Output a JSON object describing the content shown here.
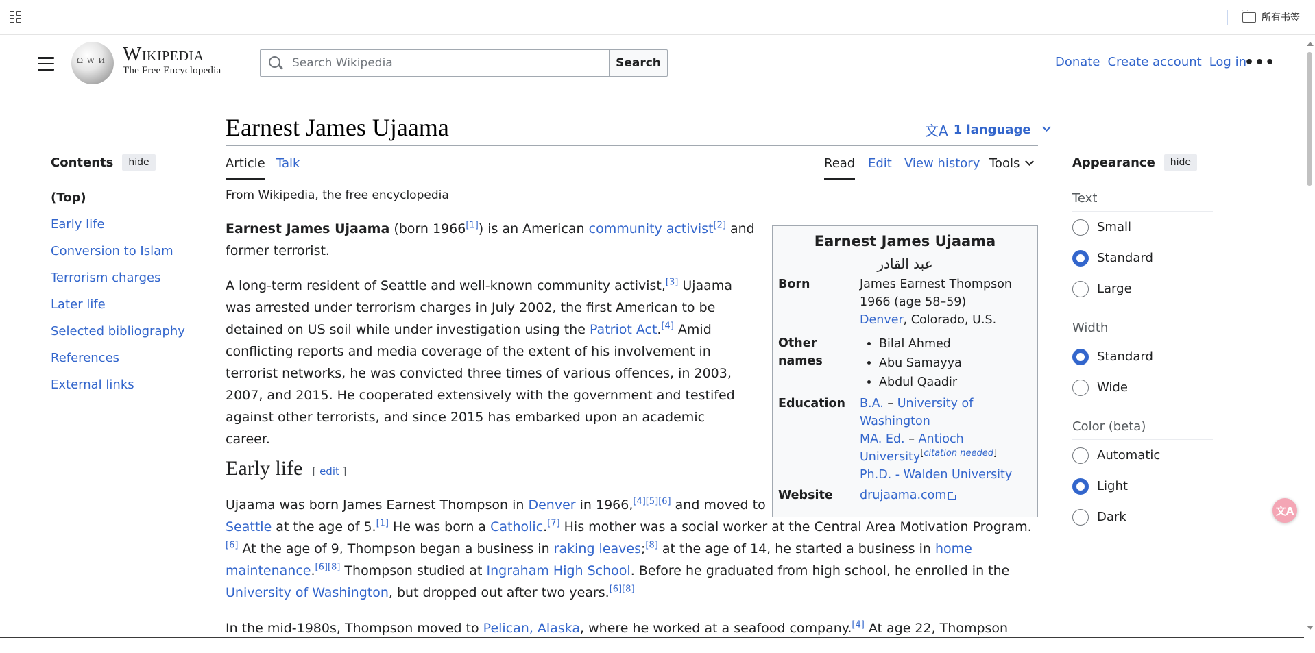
{
  "browser": {
    "bookmarks_folder": "所有书签"
  },
  "header": {
    "wordmark_title": "Wikipedia",
    "wordmark_tagline": "The Free Encyclopedia",
    "search_placeholder": "Search Wikipedia",
    "search_button": "Search",
    "user_links": [
      "Donate",
      "Create account",
      "Log in"
    ],
    "more": "•••"
  },
  "page": {
    "title": "Earnest James Ujaama",
    "language_button": "1 language",
    "language_icon": "translate-icon",
    "tabs_left": [
      "Article",
      "Talk"
    ],
    "tabs_right": [
      "Read",
      "Edit",
      "View history",
      "Tools"
    ],
    "tagline": "From Wikipedia, the free encyclopedia"
  },
  "toc": {
    "heading": "Contents",
    "hide": "hide",
    "items": [
      "(Top)",
      "Early life",
      "Conversion to Islam",
      "Terrorism charges",
      "Later life",
      "Selected bibliography",
      "References",
      "External links"
    ]
  },
  "article": {
    "p1": {
      "bold_name": "Earnest James Ujaama",
      "t1": " (born 1966",
      "ref1": "[1]",
      "t2": ") is an American ",
      "link1": "community activist",
      "ref2": "[2]",
      "t3": " and former terrorist."
    },
    "p2": {
      "t1": "A long-term resident of Seattle and well-known community activist,",
      "ref1": "[3]",
      "t2": " Ujaama was arrested under terrorism charges in July 2002, the first American to be detained on US soil while under investigation using the ",
      "link1": "Patriot Act",
      "t3": ".",
      "ref2": "[4]",
      "t4": " Amid conflicting reports and media coverage of the extent of his involvement in terrorist networks, he was convicted three times of various offences, in 2003, 2007, and 2015. He cooperated extensively with the government and testifed against other terrorists, and since 2015 has embarked upon an academic career."
    },
    "section1": {
      "heading": "Early life",
      "edit": "edit"
    },
    "p3": {
      "t1": "Ujaama was born James Earnest Thompson in ",
      "link1": "Denver",
      "t2": " in 1966,",
      "refs1": "[4][5][6]",
      "t3": " and moved to ",
      "link2": "Seattle",
      "t4": " at the age of 5.",
      "ref2": "[1]",
      "t5": " He was born a ",
      "link3": "Catholic",
      "t6": ".",
      "ref3": "[7]",
      "t7": " His mother was a social worker at the Central Area Motivation Program.",
      "ref4": "[6]",
      "t8": " At the age of 9, Thompson began a business in ",
      "link4": "raking leaves",
      "t9": ";",
      "ref5": "[8]",
      "t10": " at the age of 14, he started a business in ",
      "link5": "home maintenance",
      "t11": ".",
      "refs6": "[6][8]",
      "t12": " Thompson studied at ",
      "link6": "Ingraham High School",
      "t13": ". Before he graduated from high school, he enrolled in the ",
      "link7": "University of Washington",
      "t14": ", but dropped out after two years.",
      "refs7": "[6][8]"
    },
    "p4": {
      "t1": "In the mid-1980s, Thompson moved to ",
      "link1": "Pelican, Alaska",
      "t2": ", where he worked at a seafood company.",
      "ref1": "[4]",
      "t3": " At age 22, Thompson"
    }
  },
  "infobox": {
    "title": "Earnest James Ujaama",
    "native_name": "عبد القادر",
    "born_label": "Born",
    "born_line1": "James Earnest Thompson",
    "born_line2": "1966 (age 58–59)",
    "born_place_link": "Denver",
    "born_place_rest": ", Colorado, U.S.",
    "other_names_label": "Other names",
    "other_names": [
      "Bilal Ahmed",
      "Abu Samayya",
      "Abdul Qaadir"
    ],
    "education_label": "Education",
    "edu1_degree": "B.A.",
    "edu1_sep": " – ",
    "edu1_school": "University of Washington",
    "edu2_degree": "MA. Ed.",
    "edu2_sep": " – ",
    "edu2_school": "Antioch University",
    "edu2_cn_open": "[",
    "edu2_cn": "citation needed",
    "edu2_cn_close": "]",
    "edu3": "Ph.D. - Walden University",
    "website_label": "Website",
    "website": "drujaama.com"
  },
  "appearance": {
    "heading": "Appearance",
    "hide": "hide",
    "groups": [
      {
        "label": "Text",
        "options": [
          "Small",
          "Standard",
          "Large"
        ],
        "selected": "Standard"
      },
      {
        "label": "Width",
        "options": [
          "Standard",
          "Wide"
        ],
        "selected": "Standard"
      },
      {
        "label": "Color (beta)",
        "options": [
          "Automatic",
          "Light",
          "Dark"
        ],
        "selected": "Light"
      }
    ]
  },
  "floating": {
    "translate_icon": "translate-float-icon"
  },
  "colors": {
    "link": "#3366cc",
    "text": "#202122",
    "border": "#a2a9b1",
    "infobox_bg": "#f8f9fa"
  }
}
